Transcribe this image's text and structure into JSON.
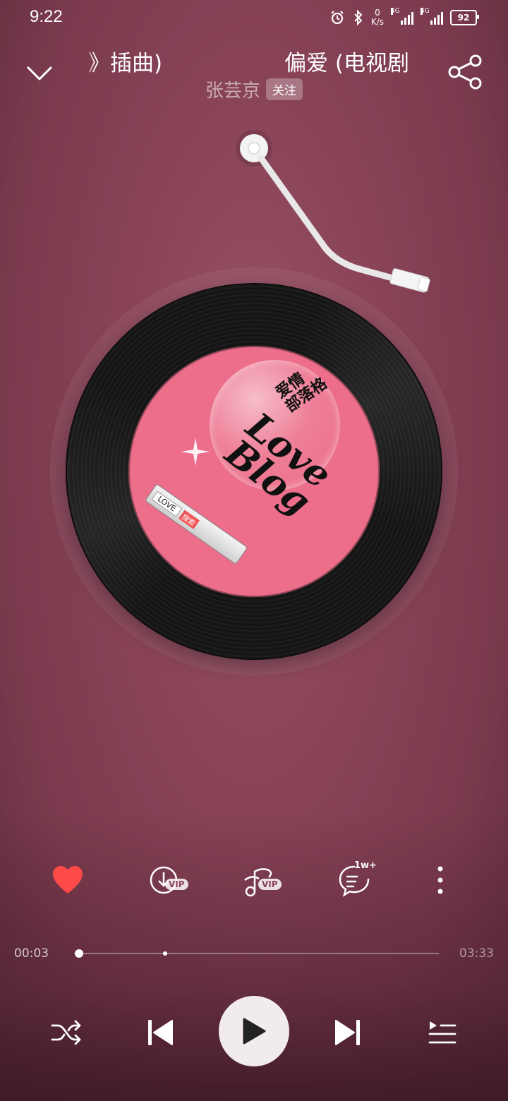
{
  "status_bar": {
    "time": "9:22",
    "net_speed_value": "0",
    "net_speed_unit": "K/s",
    "signal1_label": "4G",
    "signal2_label": "4G",
    "battery": "92"
  },
  "header": {
    "title_tail": "》插曲)",
    "title_head": "偏爱 (电视剧",
    "artist": "张芸京",
    "follow_label": "关注"
  },
  "disc": {
    "label_cn": [
      "爱情",
      "部落格"
    ],
    "label_logo": [
      "Love",
      "Blog"
    ],
    "search_text": "LOVE",
    "search_button": "搜索"
  },
  "actions": {
    "like_active": true,
    "download_badge": "VIP",
    "effect_badge": "VIP",
    "comment_count": "1w+"
  },
  "progress": {
    "current": "00:03",
    "total": "03:33",
    "played_fraction": 0.014,
    "buffered_fraction": 0.25
  },
  "colors": {
    "background": "#8a4458",
    "label": "#ec6e8a",
    "like": "#ff4a4a",
    "play_button": "#f1eceb"
  }
}
